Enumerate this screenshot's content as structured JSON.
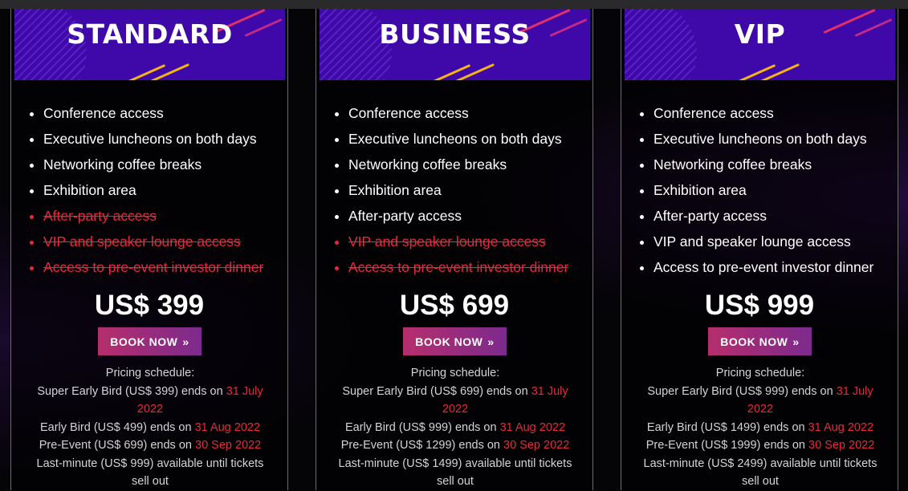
{
  "plans": [
    {
      "name": "STANDARD",
      "features": [
        {
          "text": "Conference access",
          "included": true
        },
        {
          "text": "Executive luncheons on both days",
          "included": true
        },
        {
          "text": "Networking coffee breaks",
          "included": true
        },
        {
          "text": "Exhibition area",
          "included": true
        },
        {
          "text": "After-party access",
          "included": false
        },
        {
          "text": "VIP and speaker lounge access",
          "included": false
        },
        {
          "text": "Access to pre-event investor dinner",
          "included": false
        }
      ],
      "price": "US$ 399",
      "book_label": "BOOK NOW",
      "schedule": {
        "heading": "Pricing schedule:",
        "super_early_text": "Super Early Bird (US$ 399) ends on ",
        "super_early_date": "31 July 2022",
        "early_text": "Early Bird (US$ 499) ends on ",
        "early_date": "31 Aug 2022",
        "pre_text": "Pre-Event (US$ 699) ends on ",
        "pre_date": "30 Sep 2022",
        "last_text": "Last-minute (US$ 999) available until tickets sell out"
      }
    },
    {
      "name": "BUSINESS",
      "features": [
        {
          "text": "Conference access",
          "included": true
        },
        {
          "text": "Executive luncheons on both days",
          "included": true
        },
        {
          "text": "Networking coffee breaks",
          "included": true
        },
        {
          "text": "Exhibition area",
          "included": true
        },
        {
          "text": "After-party access",
          "included": true
        },
        {
          "text": "VIP and speaker lounge access",
          "included": false
        },
        {
          "text": "Access to pre-event investor dinner",
          "included": false
        }
      ],
      "price": "US$ 699",
      "book_label": "BOOK NOW",
      "schedule": {
        "heading": "Pricing schedule:",
        "super_early_text": "Super Early Bird (US$ 699) ends on ",
        "super_early_date": "31 July 2022",
        "early_text": "Early Bird (US$ 999) ends on ",
        "early_date": "31 Aug 2022",
        "pre_text": "Pre-Event (US$ 1299) ends on ",
        "pre_date": "30 Sep 2022",
        "last_text": "Last-minute (US$ 1499) available until tickets sell out"
      }
    },
    {
      "name": "VIP",
      "features": [
        {
          "text": "Conference access",
          "included": true
        },
        {
          "text": "Executive luncheons on both days",
          "included": true
        },
        {
          "text": "Networking coffee breaks",
          "included": true
        },
        {
          "text": "Exhibition area",
          "included": true
        },
        {
          "text": "After-party access",
          "included": true
        },
        {
          "text": "VIP and speaker lounge access",
          "included": true
        },
        {
          "text": "Access to pre-event investor dinner",
          "included": true
        }
      ],
      "price": "US$ 999",
      "book_label": "BOOK NOW",
      "schedule": {
        "heading": "Pricing schedule:",
        "super_early_text": "Super Early Bird (US$ 999) ends on ",
        "super_early_date": "31 July 2022",
        "early_text": "Early Bird (US$ 1499) ends on ",
        "early_date": "31 Aug 2022",
        "pre_text": "Pre-Event (US$ 1999) ends on ",
        "pre_date": "30 Sep 2022",
        "last_text": "Last-minute (US$ 2499) available until tickets sell out"
      }
    }
  ],
  "icons": {
    "book_chevron": "double-chevron-right-icon"
  },
  "colors": {
    "banner": "#3f08a8",
    "excluded": "#e8283c",
    "button_start": "#b62e6c",
    "button_end": "#7c2a8e"
  }
}
